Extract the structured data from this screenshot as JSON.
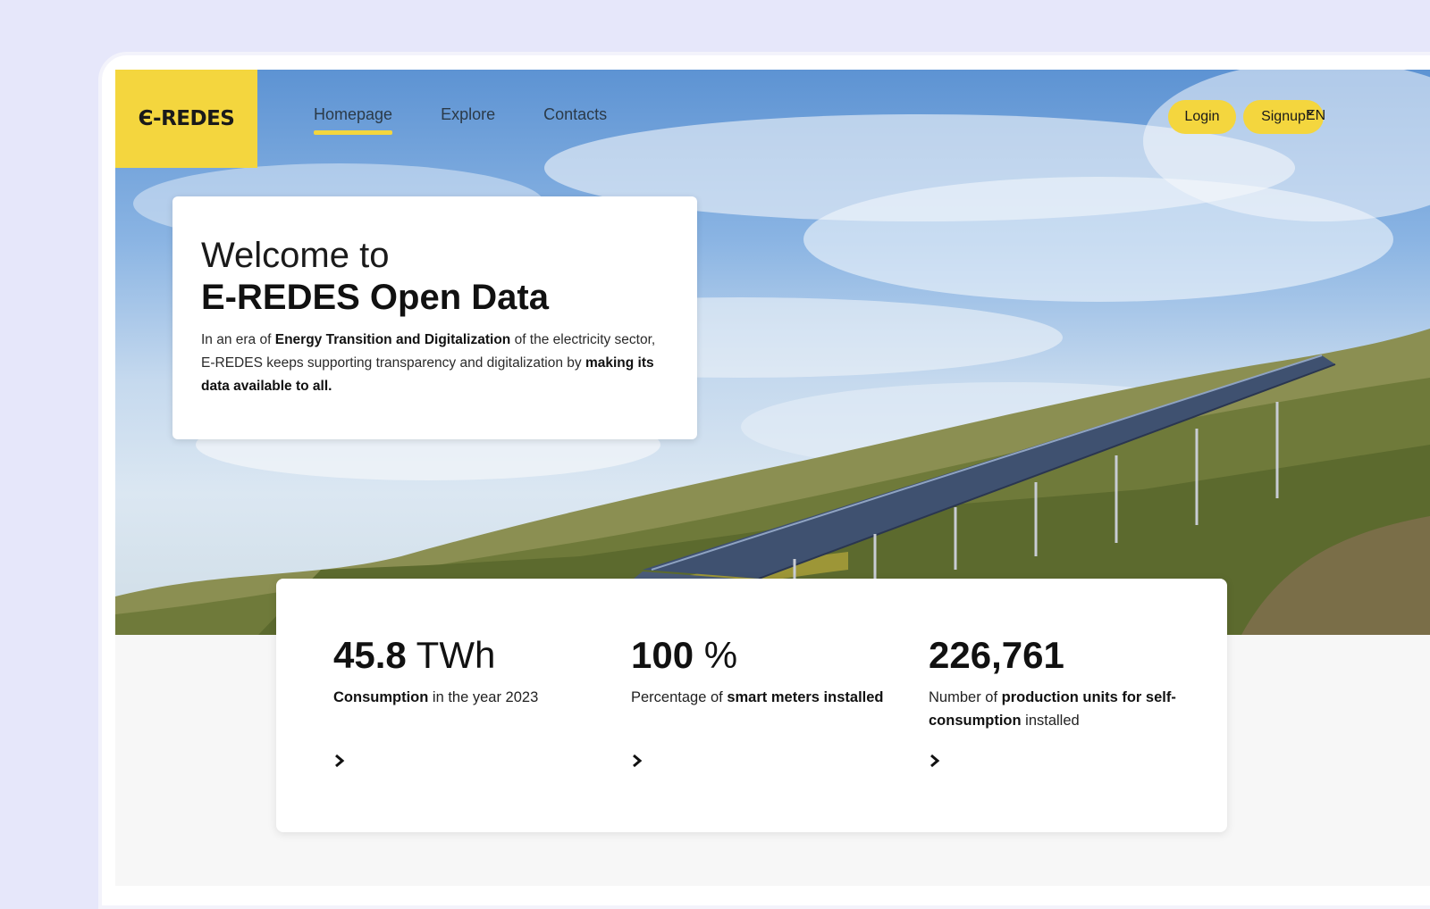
{
  "brand": {
    "logo_text": "Є-REDES"
  },
  "nav": {
    "items": [
      {
        "label": "Homepage",
        "active": true
      },
      {
        "label": "Explore",
        "active": false
      },
      {
        "label": "Contacts",
        "active": false
      }
    ]
  },
  "header": {
    "login_label": "Login",
    "signup_label": "Signup",
    "language_label": "EN"
  },
  "welcome": {
    "line1": "Welcome to",
    "line2": "E-REDES Open Data",
    "desc_a": "In an era of ",
    "desc_b": "Energy Transition and Digitalization",
    "desc_c": " of the electricity sector, E-REDES keeps supporting transparency and digitalization by ",
    "desc_d": "making its data available to all."
  },
  "stats": [
    {
      "value": "45.8",
      "unit": " TWh",
      "label_bold": "Consumption",
      "label_rest": " in the year 2023"
    },
    {
      "value": "100",
      "unit": " %",
      "label_pre": "Percentage of ",
      "label_bold": "smart meters installed"
    },
    {
      "value": "226,761",
      "unit": "",
      "label_pre": "Number of ",
      "label_bold": "production units for self-consumption",
      "label_rest": " installed"
    }
  ],
  "colors": {
    "accent": "#f4d63e",
    "page_bg": "#e6e7fa"
  },
  "icons": {
    "arrow": "chevron-right-icon",
    "language": "chevron-down-icon"
  }
}
